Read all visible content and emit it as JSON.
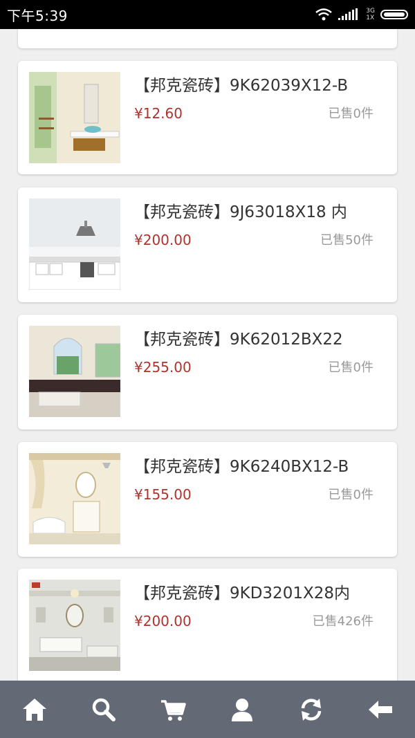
{
  "status_bar": {
    "time": "下午5:39",
    "network_type": "3G",
    "network_sim": "1X"
  },
  "products": [
    {
      "title": "【邦克瓷砖】9K62039X12-B",
      "price": "¥12.60",
      "sold": "已售0件"
    },
    {
      "title": "【邦克瓷砖】9J63018X18 内",
      "price": "¥200.00",
      "sold": "已售50件"
    },
    {
      "title": "【邦克瓷砖】9K62012BX22",
      "price": "¥255.00",
      "sold": "已售0件"
    },
    {
      "title": "【邦克瓷砖】9K6240BX12-B",
      "price": "¥155.00",
      "sold": "已售0件"
    },
    {
      "title": "【邦克瓷砖】9KD3201X28内",
      "price": "¥200.00",
      "sold": "已售426件"
    }
  ],
  "bottom_nav": [
    {
      "icon": "home-icon"
    },
    {
      "icon": "search-icon"
    },
    {
      "icon": "cart-icon"
    },
    {
      "icon": "user-icon"
    },
    {
      "icon": "refresh-icon"
    },
    {
      "icon": "back-arrow-icon"
    }
  ],
  "colors": {
    "price": "#b0322c",
    "nav_bg": "#646a75"
  }
}
